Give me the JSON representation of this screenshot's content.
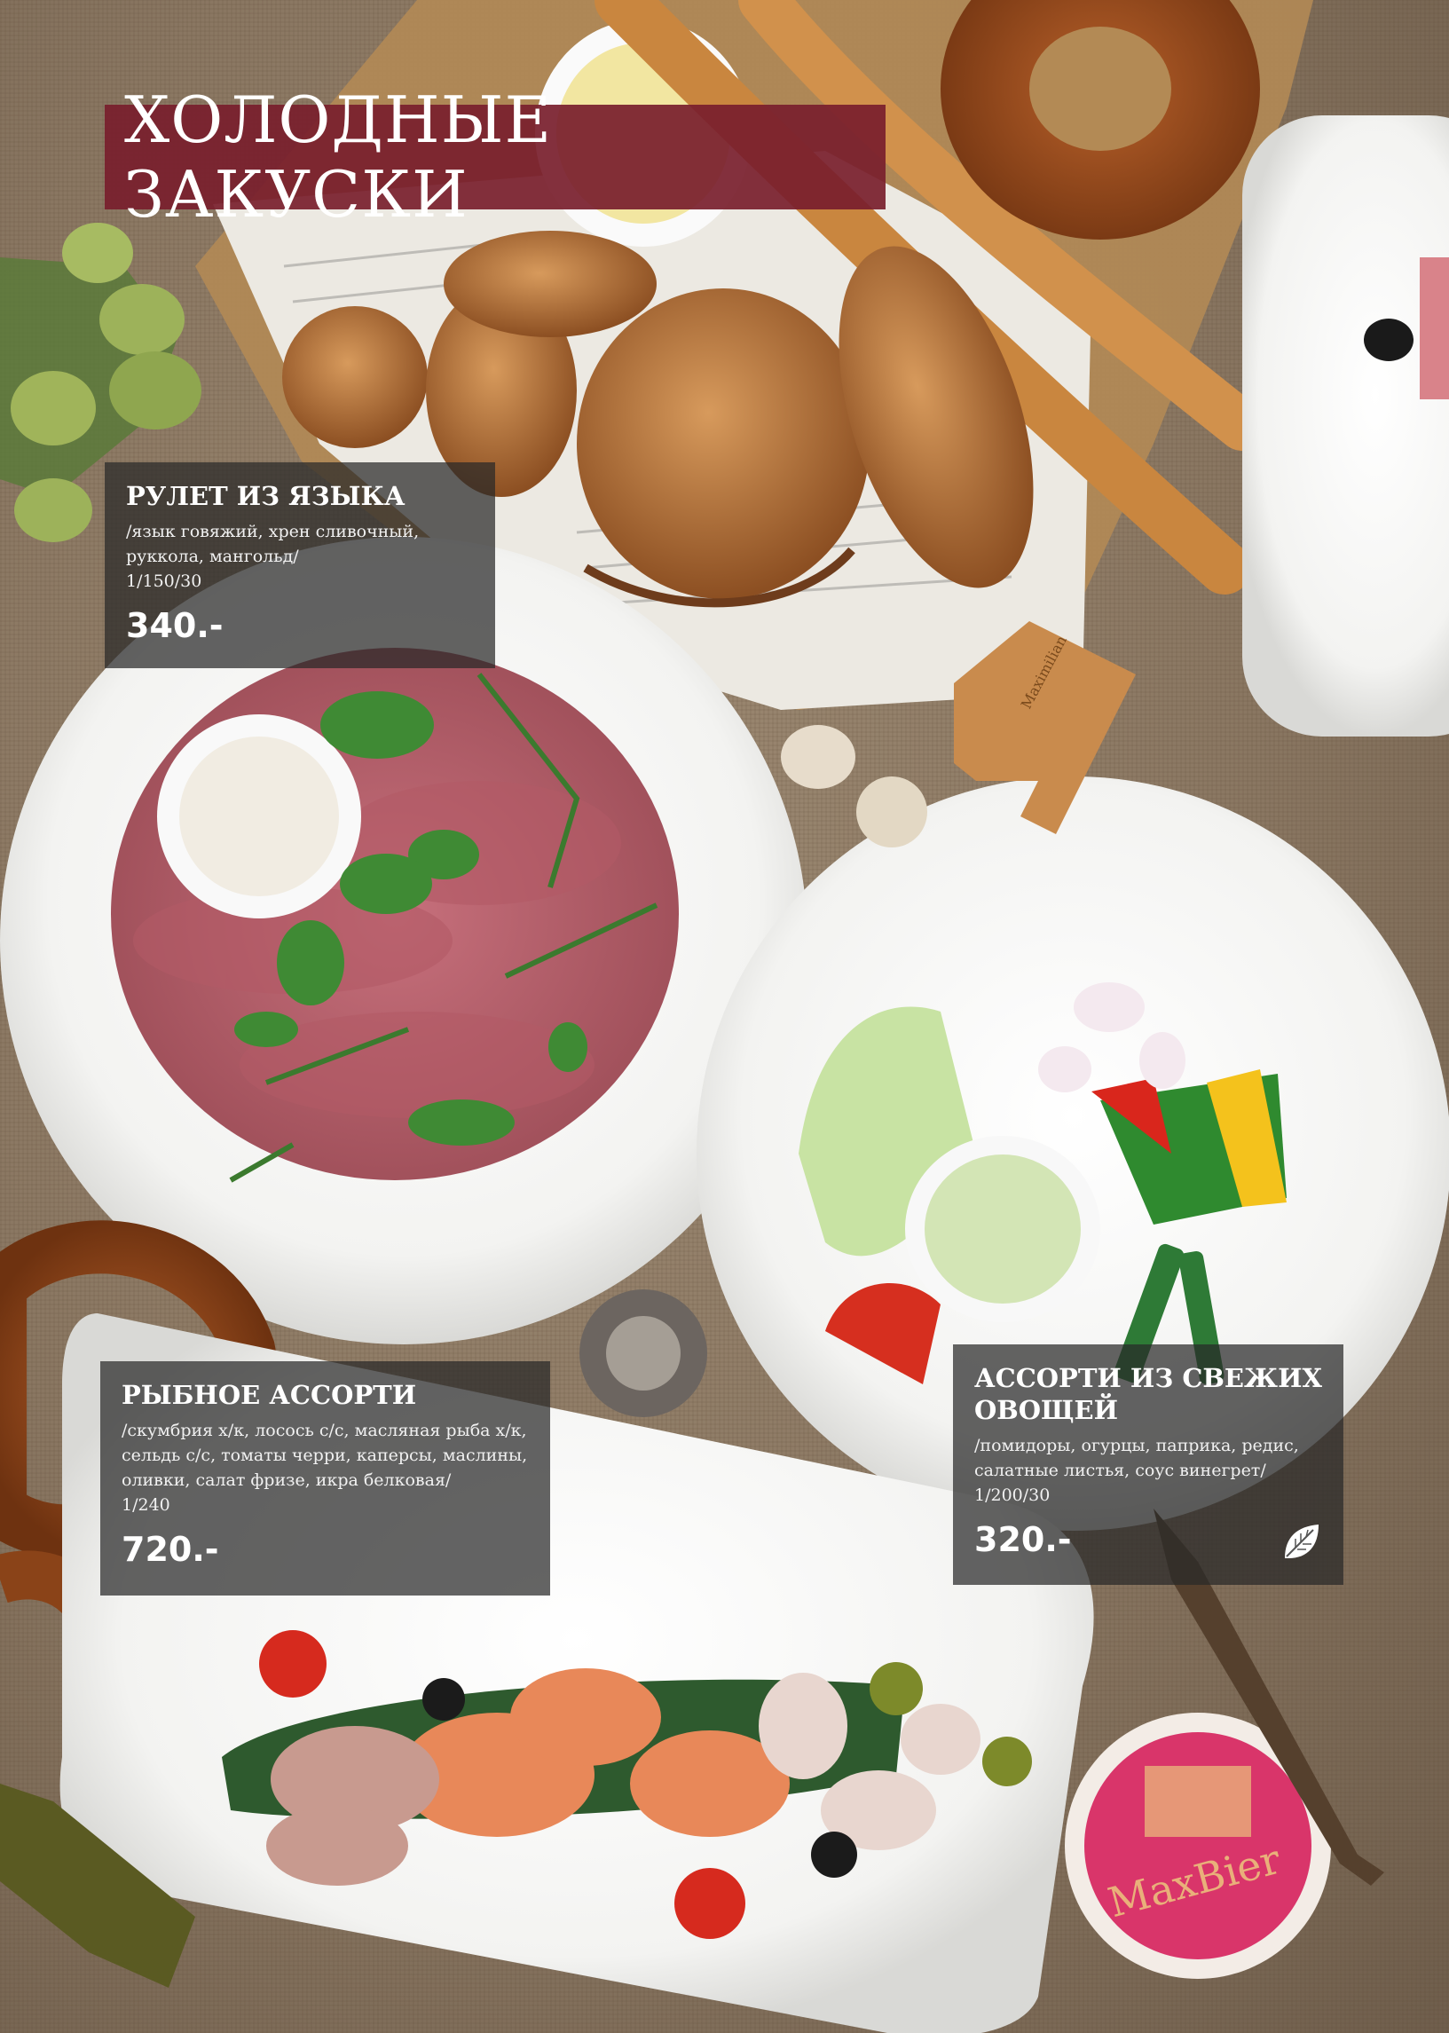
{
  "page": {
    "title": "ХОЛОДНЫЕ ЗАКУСКИ"
  },
  "dishes": [
    {
      "name": "РУЛЕТ ИЗ ЯЗЫКА",
      "description": "/язык говяжий, хрен сливочный, руккола, мангольд/",
      "portion": "1/150/30",
      "price": "340.-"
    },
    {
      "name": "РЫБНОЕ АССОРТИ",
      "description": "/скумбрия х/к, лосось с/с, масляная рыба х/к, сельдь с/с, томаты черри, каперсы, маслины, оливки, салат фризе, икра белковая/",
      "portion": "1/240",
      "price": "720.-"
    },
    {
      "name": "АССОРТИ ИЗ СВЕЖИХ ОВОЩЕЙ",
      "description": "/помидоры, огурцы, паприка, редис, салатные листья, соус винегрет/",
      "portion": "1/200/30",
      "price": "320.-",
      "badge_icon": "leaf-icon"
    }
  ],
  "decor": {
    "coaster_text": "MaxBier",
    "stand_text": "Maximilian Brauhaus"
  },
  "colors": {
    "title_band": "#7a1e2c",
    "panel": "#2b2b2b",
    "plate": "#f7f7f5",
    "coaster": "#d9356a"
  }
}
